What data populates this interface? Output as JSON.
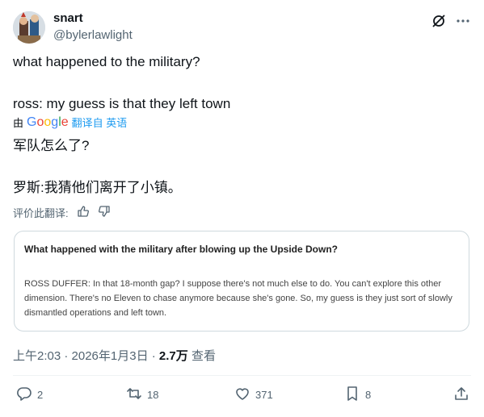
{
  "user": {
    "name": "snart",
    "handle": "@bylerlawlight"
  },
  "tweet": {
    "line1": "what happened to the military?",
    "line2": "ross: my guess is that they left town",
    "translate_prefix": "由",
    "translate_brand": "Google",
    "translate_link": "翻译自 英语",
    "zh_line1": "军队怎么了?",
    "zh_line2": "罗斯:我猜他们离开了小镇。",
    "rate_label": "评价此翻译:"
  },
  "card": {
    "title": "What happened with the military after blowing up the Upside Down?",
    "body": "ROSS DUFFER: In that 18-month gap? I suppose there's not much else to do. You can't explore this other dimension. There's no Eleven to chase anymore because she's gone. So, my guess is they just sort of slowly dismantled operations and left town."
  },
  "meta": {
    "time_date": "上午2:03 · 2026年1月3日 · ",
    "views": "2.7万",
    "views_label": " 查看"
  },
  "actions": {
    "reply_count": "2",
    "retweet_count": "18",
    "like_count": "371",
    "bookmark_count": "8"
  },
  "icons": [
    "grok-icon",
    "more-icon",
    "thumbs-up-icon",
    "thumbs-down-icon",
    "reply-icon",
    "retweet-icon",
    "like-icon",
    "bookmark-icon",
    "share-icon"
  ]
}
